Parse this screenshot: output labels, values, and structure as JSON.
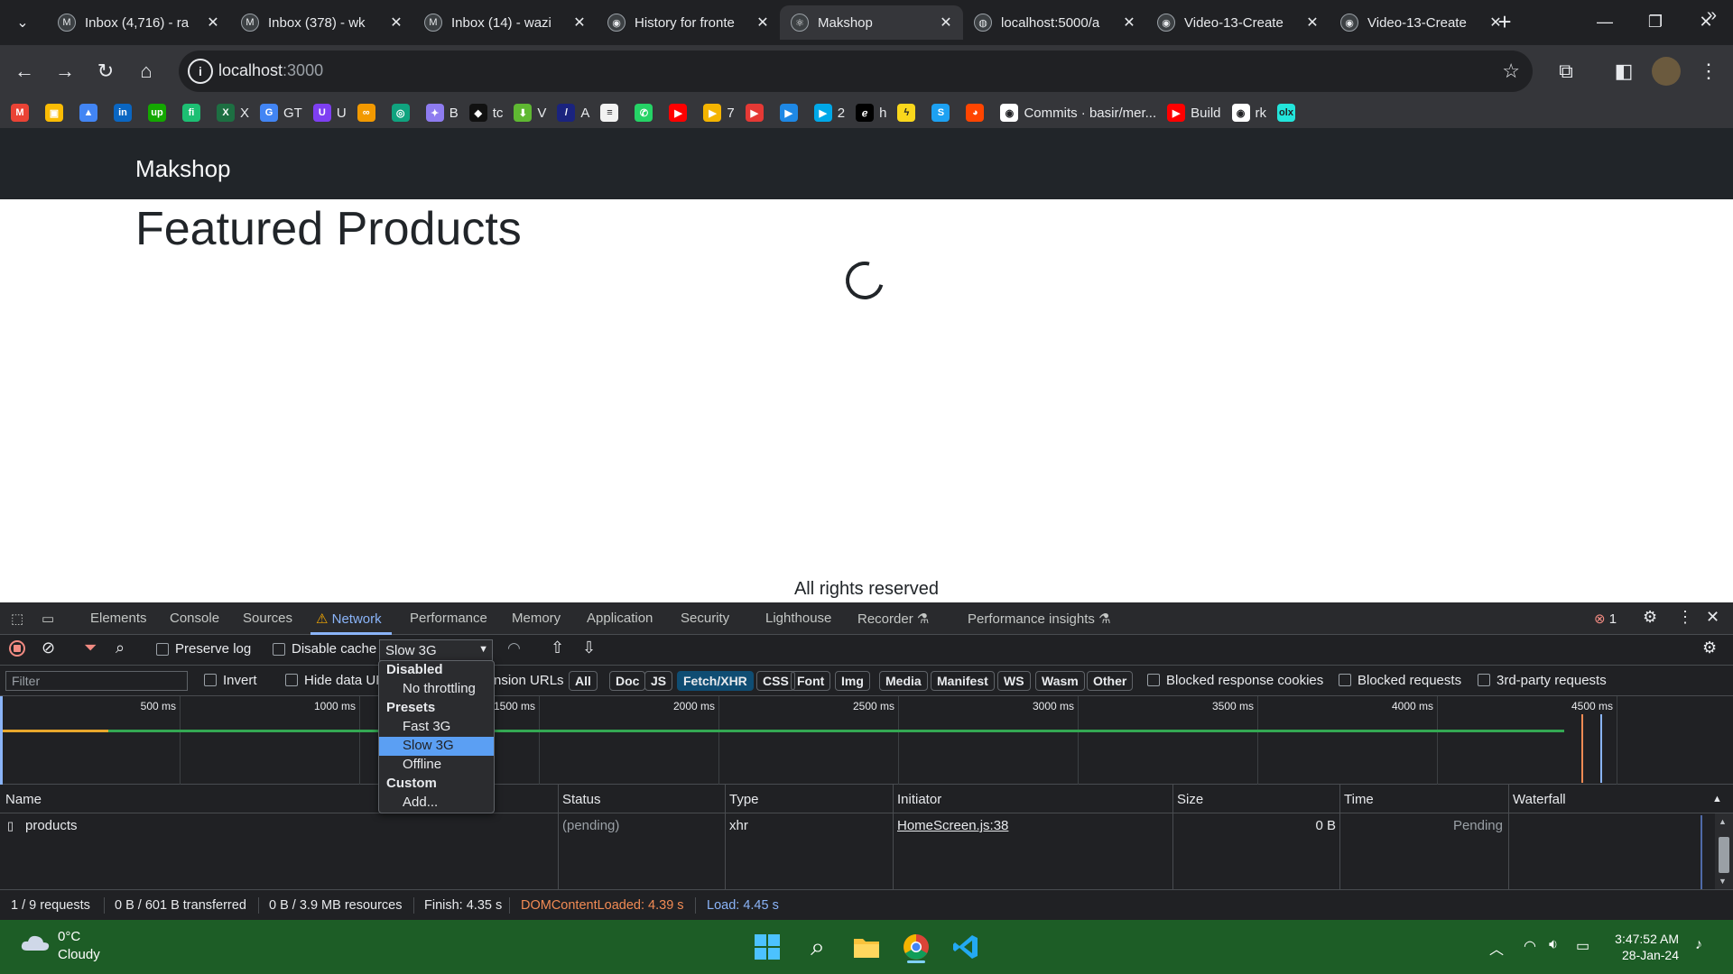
{
  "browser": {
    "tabs": [
      {
        "title": "Inbox (4,716) - ra",
        "icon": "gmail-icon",
        "glyph": "M"
      },
      {
        "title": "Inbox (378) - wk",
        "icon": "gmail-icon",
        "glyph": "M"
      },
      {
        "title": "Inbox (14) - wazi",
        "icon": "gmail-icon",
        "glyph": "M"
      },
      {
        "title": "History for fronte",
        "icon": "github-icon",
        "glyph": "◉"
      },
      {
        "title": "Makshop",
        "icon": "react-icon",
        "glyph": "⚛",
        "active": true
      },
      {
        "title": "localhost:5000/a",
        "icon": "globe-icon",
        "glyph": "◍"
      },
      {
        "title": "Video-13-Create",
        "icon": "github-icon",
        "glyph": "◉"
      },
      {
        "title": "Video-13-Create",
        "icon": "github-icon",
        "glyph": "◉"
      }
    ],
    "new_tab": "+",
    "url_host": "localhost",
    "url_port": ":3000",
    "bookmarks": [
      {
        "label": "",
        "icon": "gmail-icon",
        "glyph": "M",
        "color": "#ea4335"
      },
      {
        "label": "",
        "icon": "photos-icon",
        "glyph": "▣",
        "color": "#fbbc04"
      },
      {
        "label": "",
        "icon": "triangle-icon",
        "glyph": "▲",
        "color": "#4285f4"
      },
      {
        "label": "",
        "icon": "linkedin-icon",
        "glyph": "in",
        "color": "#0a66c2"
      },
      {
        "label": "",
        "icon": "upwork-icon",
        "glyph": "up",
        "color": "#14a800"
      },
      {
        "label": "",
        "icon": "fiverr-icon",
        "glyph": "fi",
        "color": "#1dbf73"
      },
      {
        "label": "X",
        "icon": "excel-icon",
        "glyph": "X",
        "color": "#1d6f42"
      },
      {
        "label": "GT",
        "icon": "google-icon",
        "glyph": "G",
        "color": "#4285f4"
      },
      {
        "label": "U",
        "icon": "u-icon",
        "glyph": "U",
        "color": "#7e3ff2"
      },
      {
        "label": "",
        "icon": "infinity-icon",
        "glyph": "∞",
        "color": "#f29900"
      },
      {
        "label": "",
        "icon": "chatgpt-icon",
        "glyph": "◎",
        "color": "#10a37f"
      },
      {
        "label": "B",
        "icon": "gemini-icon",
        "glyph": "✦",
        "color": "#8e7cf0"
      },
      {
        "label": "tc",
        "icon": "tc-icon",
        "glyph": "◆",
        "color": "#111111"
      },
      {
        "label": "V",
        "icon": "download-arrow-icon",
        "glyph": "⬇",
        "color": "#5fb832"
      },
      {
        "label": "A",
        "icon": "a-icon",
        "glyph": "/",
        "color": "#1a237e"
      },
      {
        "label": "",
        "icon": "stripe-icon",
        "glyph": "≡",
        "color": "#f2f2f2"
      },
      {
        "label": "",
        "icon": "whatsapp-icon",
        "glyph": "✆",
        "color": "#25d366"
      },
      {
        "label": "",
        "icon": "youtube-icon",
        "glyph": "▶",
        "color": "#ff0000"
      },
      {
        "label": "7",
        "icon": "play-icon",
        "glyph": "▶",
        "color": "#f4b400"
      },
      {
        "label": "",
        "icon": "play-red-icon",
        "glyph": "▶",
        "color": "#e53935"
      },
      {
        "label": "",
        "icon": "play-blue-icon",
        "glyph": "▶",
        "color": "#1e88e5"
      },
      {
        "label": "2",
        "icon": "play-cyan-icon",
        "glyph": "▶",
        "color": "#00a8e8"
      },
      {
        "label": "h",
        "icon": "e-icon",
        "glyph": "ℯ",
        "color": "#000000"
      },
      {
        "label": "",
        "icon": "bolt-icon",
        "glyph": "ϟ",
        "color": "#f9d71c"
      },
      {
        "label": "",
        "icon": "s-icon",
        "glyph": "S",
        "color": "#1da1f2"
      },
      {
        "label": "",
        "icon": "reddit-icon",
        "glyph": "◕",
        "color": "#ff4500"
      },
      {
        "label": "Commits · basir/mer...",
        "icon": "github-icon",
        "glyph": "◉",
        "color": "#ffffff"
      },
      {
        "label": "Build",
        "icon": "youtube-icon",
        "glyph": "▶",
        "color": "#ff0000"
      },
      {
        "label": "rk",
        "icon": "github-icon",
        "glyph": "◉",
        "color": "#ffffff"
      },
      {
        "label": "",
        "icon": "olx-icon",
        "glyph": "olx",
        "color": "#23e5db"
      }
    ],
    "more_bookmarks": "»"
  },
  "page": {
    "brand": "Makshop",
    "heading": "Featured Products",
    "footer": "All rights reserved"
  },
  "devtools": {
    "tabs": [
      "Elements",
      "Console",
      "Sources",
      "Network",
      "Performance",
      "Memory",
      "Application",
      "Security",
      "Lighthouse",
      "Recorder",
      "Performance insights"
    ],
    "active_tab": "Network",
    "error_count": "1",
    "toolbar": {
      "preserve_log": "Preserve log",
      "disable_cache": "Disable cache",
      "throttle_value": "Slow 3G"
    },
    "filter": {
      "placeholder": "Filter",
      "invert": "Invert",
      "hide_data_urls": "Hide data URLs",
      "extension_urls": "nsion URLs",
      "types": [
        "All",
        "Doc",
        "JS",
        "Fetch/XHR",
        "CSS",
        "Font",
        "Img",
        "Media",
        "Manifest",
        "WS",
        "Wasm",
        "Other"
      ],
      "selected_type": "Fetch/XHR",
      "blocked_cookies": "Blocked response cookies",
      "blocked_requests": "Blocked requests",
      "third_party": "3rd-party requests"
    },
    "overview_ticks": [
      "500 ms",
      "1000 ms",
      "1500 ms",
      "2000 ms",
      "2500 ms",
      "3000 ms",
      "3500 ms",
      "4000 ms",
      "4500 ms"
    ],
    "columns": [
      "Name",
      "Status",
      "Type",
      "Initiator",
      "Size",
      "Time",
      "Waterfall"
    ],
    "rows": [
      {
        "name": "products",
        "status": "(pending)",
        "type": "xhr",
        "initiator": "HomeScreen.js:38",
        "size": "0 B",
        "time": "Pending"
      }
    ],
    "throttle_menu": {
      "disabled": "Disabled",
      "no_throttling": "No throttling",
      "presets": "Presets",
      "fast3g": "Fast 3G",
      "slow3g": "Slow 3G",
      "offline": "Offline",
      "custom": "Custom",
      "add": "Add..."
    },
    "status": {
      "requests": "1 / 9 requests",
      "transferred": "0 B / 601 B transferred",
      "resources": "0 B / 3.9 MB resources",
      "finish": "Finish: 4.35 s",
      "dcl": "DOMContentLoaded: 4.39 s",
      "load": "Load: 4.45 s"
    },
    "colors": {
      "dcl": "#f28b54",
      "load": "#8ab4f8",
      "accent": "#8ab4f8"
    }
  },
  "taskbar": {
    "temperature": "0°C",
    "weather": "Cloudy",
    "time": "3:47:52 AM",
    "date": "28-Jan-24"
  }
}
